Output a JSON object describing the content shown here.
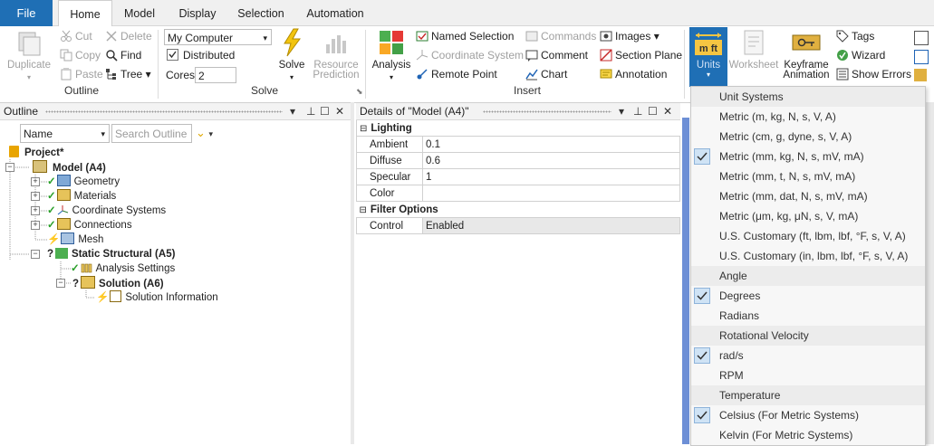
{
  "menubar": {
    "file": "File",
    "tabs": [
      "Home",
      "Model",
      "Display",
      "Selection",
      "Automation"
    ],
    "active_tab": "Home"
  },
  "ribbon": {
    "outline_group": {
      "label": "Outline",
      "duplicate": "Duplicate",
      "cut": "Cut",
      "copy": "Copy",
      "paste": "Paste",
      "delete": "Delete",
      "find": "Find",
      "tree": "Tree"
    },
    "solve_group": {
      "label": "Solve",
      "location_value": "My Computer",
      "distributed_label": "Distributed",
      "distributed_checked": true,
      "cores_label": "Cores",
      "cores_value": "2",
      "solve": "Solve",
      "resource_prediction_1": "Resource",
      "resource_prediction_2": "Prediction"
    },
    "insert_group": {
      "label": "Insert",
      "analysis": "Analysis",
      "named_selection": "Named Selection",
      "coordinate_system": "Coordinate System",
      "remote_point": "Remote Point",
      "commands": "Commands",
      "comment": "Comment",
      "chart": "Chart",
      "images": "Images",
      "section_plane": "Section Plane",
      "annotation": "Annotation"
    },
    "tools_group": {
      "units": "Units",
      "units_icon_text": "m ft",
      "worksheet": "Worksheet",
      "keyframe_1": "Keyframe",
      "keyframe_2": "Animation",
      "tags": "Tags",
      "wizard": "Wizard",
      "show_errors": "Show Errors"
    }
  },
  "outline": {
    "title": "Outline",
    "filter_value": "Name",
    "search_placeholder": "Search Outline",
    "tree": [
      {
        "label": "Project*",
        "bold": true
      },
      {
        "label": "Model (A4)",
        "bold": true
      },
      {
        "label": "Geometry",
        "bold": false
      },
      {
        "label": "Materials",
        "bold": false
      },
      {
        "label": "Coordinate Systems",
        "bold": false
      },
      {
        "label": "Connections",
        "bold": false
      },
      {
        "label": "Mesh",
        "bold": false
      },
      {
        "label": "Static Structural (A5)",
        "bold": true
      },
      {
        "label": "Analysis Settings",
        "bold": false
      },
      {
        "label": "Solution (A6)",
        "bold": true
      },
      {
        "label": "Solution Information",
        "bold": false
      }
    ]
  },
  "details": {
    "title": "Details of \"Model (A4)\"",
    "lighting_header": "Lighting",
    "ambient_label": "Ambient",
    "ambient_value": "0.1",
    "diffuse_label": "Diffuse",
    "diffuse_value": "0.6",
    "specular_label": "Specular",
    "specular_value": "1",
    "color_label": "Color",
    "color_value": "",
    "filter_header": "Filter Options",
    "control_label": "Control",
    "control_value": "Enabled"
  },
  "units_menu": {
    "unit_systems_header": "Unit Systems",
    "unit_systems": [
      {
        "label": "Metric (m, kg, N, s, V, A)",
        "checked": false
      },
      {
        "label": "Metric (cm, g, dyne, s, V, A)",
        "checked": false
      },
      {
        "label": "Metric (mm, kg, N, s, mV, mA)",
        "checked": true
      },
      {
        "label": "Metric (mm, t, N, s, mV, mA)",
        "checked": false
      },
      {
        "label": "Metric (mm, dat, N, s, mV, mA)",
        "checked": false
      },
      {
        "label": "Metric (μm, kg, μN, s, V, mA)",
        "checked": false
      },
      {
        "label": "U.S. Customary (ft, lbm, lbf, °F, s, V, A)",
        "checked": false
      },
      {
        "label": "U.S. Customary (in, lbm, lbf, °F, s, V, A)",
        "checked": false
      }
    ],
    "angle_header": "Angle",
    "angle": [
      {
        "label": "Degrees",
        "checked": true
      },
      {
        "label": "Radians",
        "checked": false
      }
    ],
    "rot_header": "Rotational Velocity",
    "rot": [
      {
        "label": "rad/s",
        "checked": true
      },
      {
        "label": "RPM",
        "checked": false
      }
    ],
    "temp_header": "Temperature",
    "temp": [
      {
        "label": "Celsius (For Metric Systems)",
        "checked": true
      },
      {
        "label": "Kelvin (For Metric Systems)",
        "checked": false
      }
    ]
  },
  "colors": {
    "file_tab": "#1f6fb5",
    "units_button": "#1f6fb5",
    "check_fill": "#cfe3f5",
    "ok_green": "#2aa02a",
    "pending_yellow": "#e8c000"
  }
}
